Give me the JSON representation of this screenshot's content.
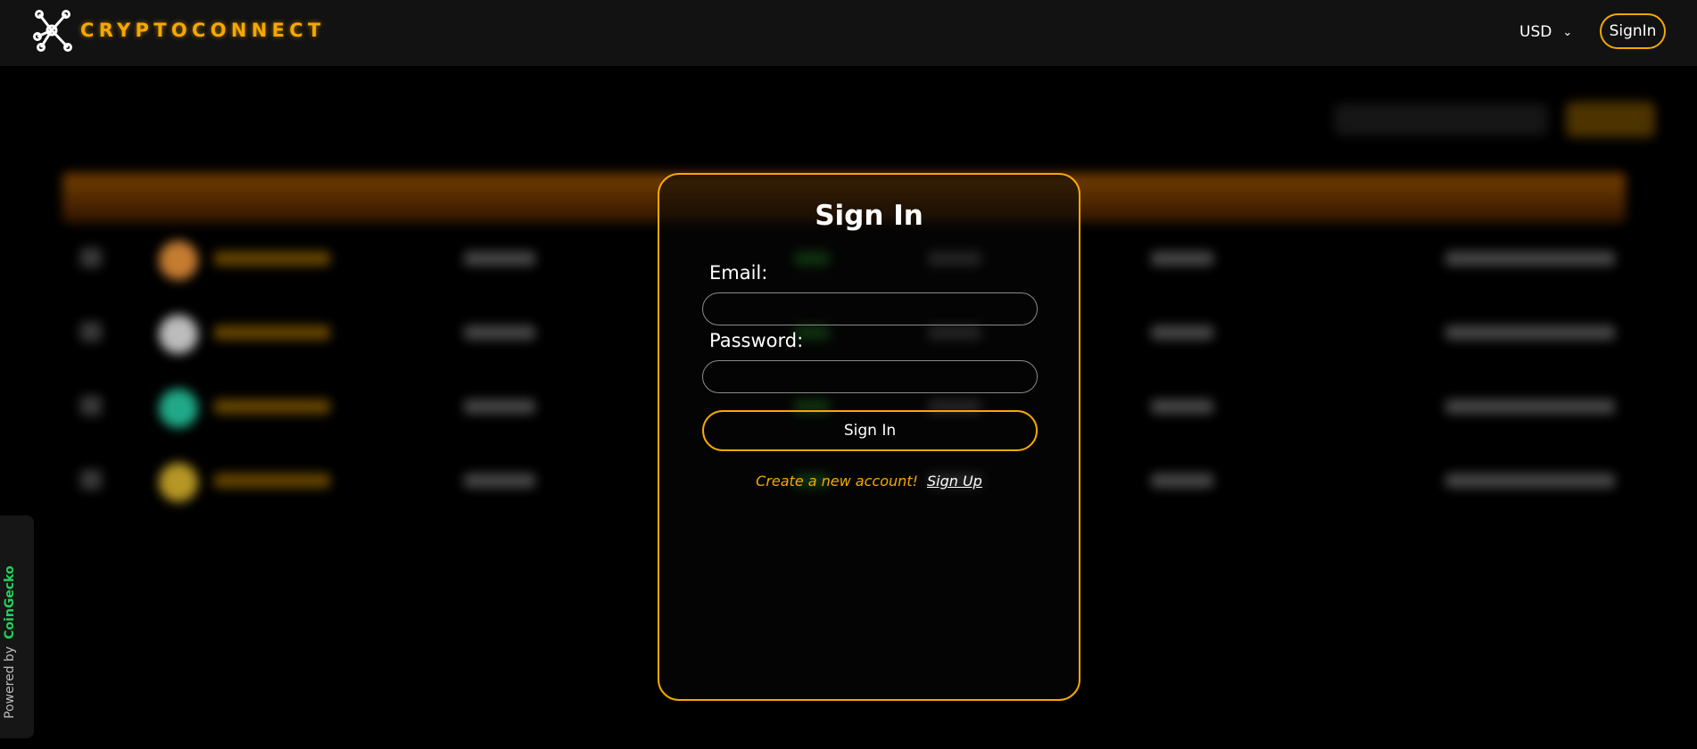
{
  "header": {
    "logo_text": "CRYPTOCONNECT",
    "logo_icon": "network-nodes-icon",
    "currency": "USD",
    "signin_label": "SignIn"
  },
  "powered_by": {
    "prefix": "Powered by",
    "brand": "CoinGecko"
  },
  "modal": {
    "title": "Sign In",
    "email_label": "Email:",
    "email_value": "",
    "password_label": "Password:",
    "password_value": "",
    "submit_label": "Sign In",
    "signup_prompt": "Create a new account!",
    "signup_link": "Sign Up"
  },
  "colors": {
    "accent": "#f5a800",
    "coingecko": "#24d05a",
    "background": "#000000",
    "header_bg": "#121212"
  },
  "background_rows": [
    {
      "coin_color": "#e8923a"
    },
    {
      "coin_color": "#dddddd"
    },
    {
      "coin_color": "#26c7a0"
    },
    {
      "coin_color": "#d6b12b"
    }
  ]
}
